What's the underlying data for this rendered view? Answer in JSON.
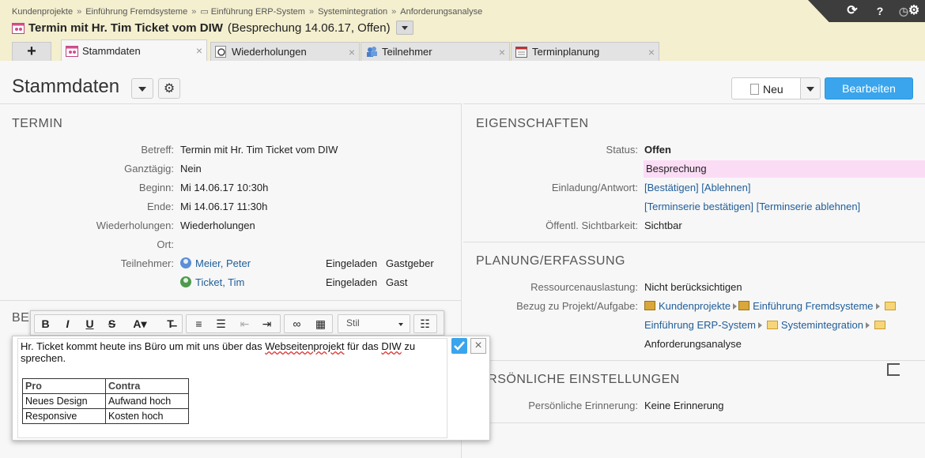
{
  "breadcrumb": [
    "Kundenprojekte",
    "Einführung Fremdsysteme",
    "Einführung ERP-System",
    "Systemintegration",
    "Anforderungsanalyse"
  ],
  "breadcrumb_sep": "»",
  "title": {
    "main": "Termin mit Hr. Tim Ticket vom DIW",
    "sub": "(Besprechung 14.06.17, Offen)"
  },
  "toolbar": {
    "help_label": "?"
  },
  "tabs": {
    "add_label": "+",
    "items": [
      {
        "label": "Stammdaten",
        "active": true
      },
      {
        "label": "Wiederholungen",
        "active": false
      },
      {
        "label": "Teilnehmer",
        "active": false
      },
      {
        "label": "Terminplanung",
        "active": false
      }
    ],
    "close_glyph": "×"
  },
  "page": {
    "title": "Stammdaten",
    "new_label": "Neu",
    "edit_label": "Bearbeiten"
  },
  "termin": {
    "section_title": "TERMIN",
    "rows": [
      {
        "label": "Betreff:",
        "value": "Termin mit Hr. Tim Ticket vom DIW"
      },
      {
        "label": "Ganztägig:",
        "value": "Nein"
      },
      {
        "label": "Beginn:",
        "value": "Mi 14.06.17 10:30h"
      },
      {
        "label": "Ende:",
        "value": "Mi 14.06.17 11:30h"
      },
      {
        "label": "Wiederholungen:",
        "value": "Wiederholungen"
      },
      {
        "label": "Ort:",
        "value": ""
      }
    ],
    "participants_label": "Teilnehmer:",
    "participants": [
      {
        "name": "Meier, Peter",
        "status": "Eingeladen",
        "role": "Gastgeber"
      },
      {
        "name": "Ticket, Tim",
        "status": "Eingeladen",
        "role": "Gast"
      }
    ],
    "beschreibung_partial": "BE"
  },
  "eigenschaften": {
    "section_title": "EIGENSCHAFTEN",
    "status_label": "Status:",
    "status_value": "Offen",
    "type_value": "Besprechung",
    "type_color": "#fbdcf5",
    "invite_label": "Einladung/Antwort:",
    "invite_confirm": "[Bestätigen]",
    "invite_decline": "[Ablehnen]",
    "series_confirm": "[Terminserie bestätigen]",
    "series_decline": "[Terminserie ablehnen]",
    "visibility_label": "Öffentl. Sichtbarkeit:",
    "visibility_value": "Sichtbar"
  },
  "planung": {
    "section_title": "PLANUNG/ERFASSUNG",
    "resource_label": "Ressourcenauslastung:",
    "resource_value": "Nicht berücksichtigen",
    "bezug_label": "Bezug zu Projekt/Aufgabe:",
    "bezug": {
      "p1": "Kundenprojekte",
      "p2": "Einführung Fremdsysteme",
      "p3": "Einführung ERP-System",
      "p4": "Systemintegration",
      "p5": "Anforderungsanalyse"
    }
  },
  "persoenlich": {
    "section_title": "ERSÖNLICHE EINSTELLUNGEN",
    "reminder_label": "Persönliche Erinnerung:",
    "reminder_value": "Keine Erinnerung"
  },
  "editor": {
    "style_placeholder": "Stil",
    "text_before": "Hr. Ticket kommt heute ins Büro um mit uns über das ",
    "text_link1": "Webseitenprojekt",
    "text_mid": " für das ",
    "text_link2": "DIW",
    "text_after": " zu",
    "text_line2": "sprechen.",
    "table_headers": [
      "Pro",
      "Contra"
    ],
    "table_rows": [
      [
        "Neues Design",
        "Aufwand hoch"
      ],
      [
        "Responsive",
        "Kosten hoch"
      ]
    ],
    "cancel_glyph": "×"
  },
  "colors": {
    "header_bg": "#f3efcf",
    "accent": "#3aa5ec",
    "link": "#1f5d99"
  }
}
